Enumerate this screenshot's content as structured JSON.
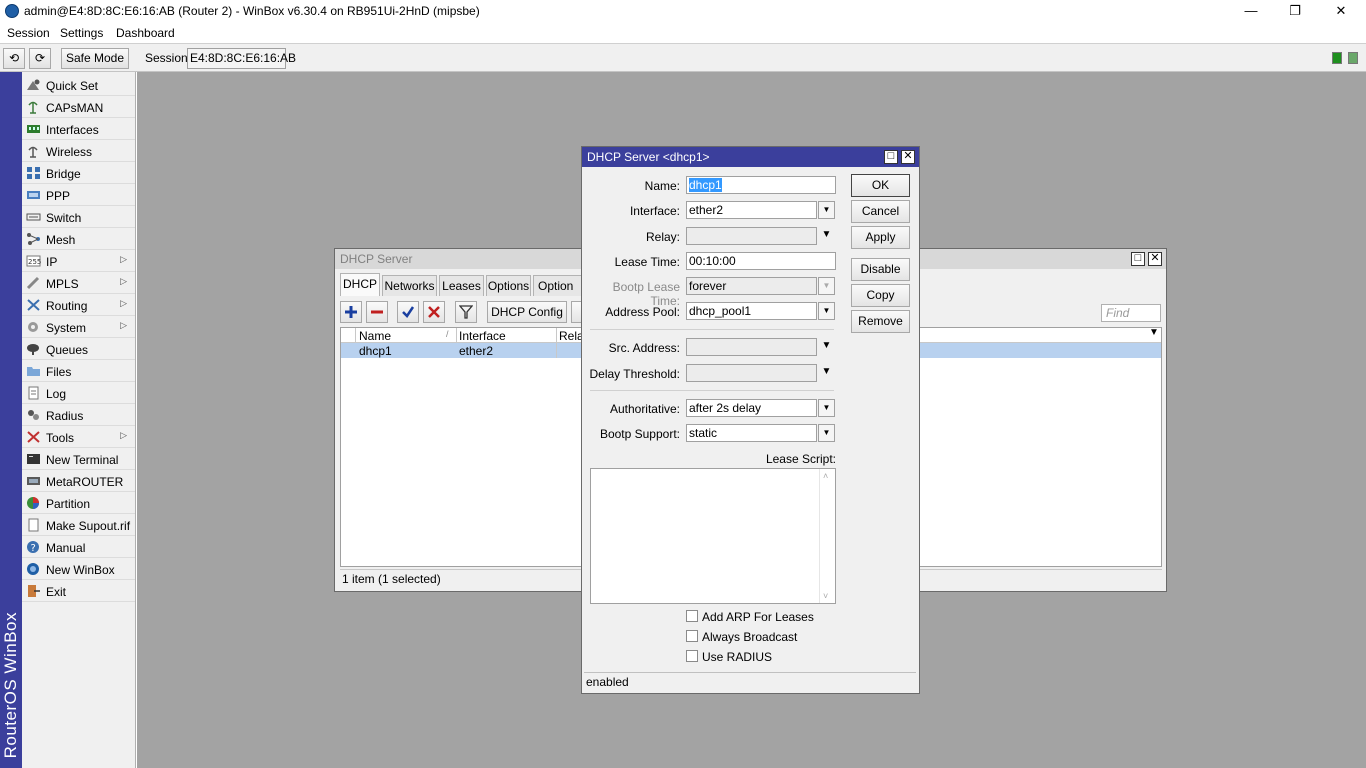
{
  "window": {
    "title": "admin@E4:8D:8C:E6:16:AB (Router 2) - WinBox v6.30.4 on RB951Ui-2HnD (mipsbe)",
    "minimize": "—",
    "restore": "❐",
    "close": "✕"
  },
  "menu": [
    "Session",
    "Settings",
    "Dashboard"
  ],
  "toolbar": {
    "undo": "⟲",
    "redo": "⟳",
    "safe_mode": "Safe Mode",
    "session_label": "Session:",
    "session_value": "E4:8D:8C:E6:16:AB"
  },
  "brand": "RouterOS WinBox",
  "sidebar": [
    {
      "label": "Quick Set",
      "icon": "quick-set-icon",
      "submenu": false
    },
    {
      "label": "CAPsMAN",
      "icon": "capsman-icon",
      "submenu": false
    },
    {
      "label": "Interfaces",
      "icon": "interfaces-icon",
      "submenu": false
    },
    {
      "label": "Wireless",
      "icon": "wireless-icon",
      "submenu": false
    },
    {
      "label": "Bridge",
      "icon": "bridge-icon",
      "submenu": false
    },
    {
      "label": "PPP",
      "icon": "ppp-icon",
      "submenu": false
    },
    {
      "label": "Switch",
      "icon": "switch-icon",
      "submenu": false
    },
    {
      "label": "Mesh",
      "icon": "mesh-icon",
      "submenu": false
    },
    {
      "label": "IP",
      "icon": "ip-icon",
      "submenu": true
    },
    {
      "label": "MPLS",
      "icon": "mpls-icon",
      "submenu": true
    },
    {
      "label": "Routing",
      "icon": "routing-icon",
      "submenu": true
    },
    {
      "label": "System",
      "icon": "system-icon",
      "submenu": true
    },
    {
      "label": "Queues",
      "icon": "queues-icon",
      "submenu": false
    },
    {
      "label": "Files",
      "icon": "files-icon",
      "submenu": false
    },
    {
      "label": "Log",
      "icon": "log-icon",
      "submenu": false
    },
    {
      "label": "Radius",
      "icon": "radius-icon",
      "submenu": false
    },
    {
      "label": "Tools",
      "icon": "tools-icon",
      "submenu": true
    },
    {
      "label": "New Terminal",
      "icon": "terminal-icon",
      "submenu": false
    },
    {
      "label": "MetaROUTER",
      "icon": "metarouter-icon",
      "submenu": false
    },
    {
      "label": "Partition",
      "icon": "partition-icon",
      "submenu": false
    },
    {
      "label": "Make Supout.rif",
      "icon": "supout-icon",
      "submenu": false
    },
    {
      "label": "Manual",
      "icon": "manual-icon",
      "submenu": false
    },
    {
      "label": "New WinBox",
      "icon": "winbox-icon",
      "submenu": false
    },
    {
      "label": "Exit",
      "icon": "exit-icon",
      "submenu": false
    }
  ],
  "dhcp_list": {
    "title": "DHCP Server",
    "tabs": [
      "DHCP",
      "Networks",
      "Leases",
      "Options",
      "Option Se"
    ],
    "buttons": {
      "dhcp_config": "DHCP Config"
    },
    "find_placeholder": "Find",
    "columns": [
      "Name",
      "Interface",
      "Relay"
    ],
    "rows": [
      {
        "name": "dhcp1",
        "interface": "ether2"
      }
    ],
    "status": "1 item (1 selected)"
  },
  "dialog": {
    "title": "DHCP Server <dhcp1>",
    "fields": {
      "name": {
        "label": "Name:",
        "value": "dhcp1"
      },
      "interface": {
        "label": "Interface:",
        "value": "ether2"
      },
      "relay": {
        "label": "Relay:",
        "value": ""
      },
      "lease_time": {
        "label": "Lease Time:",
        "value": "00:10:00"
      },
      "bootp_lease_time": {
        "label": "Bootp Lease Time:",
        "value": "forever"
      },
      "address_pool": {
        "label": "Address Pool:",
        "value": "dhcp_pool1"
      },
      "src_address": {
        "label": "Src. Address:",
        "value": ""
      },
      "delay_threshold": {
        "label": "Delay Threshold:",
        "value": ""
      },
      "authoritative": {
        "label": "Authoritative:",
        "value": "after 2s delay"
      },
      "bootp_support": {
        "label": "Bootp Support:",
        "value": "static"
      },
      "lease_script": {
        "label": "Lease Script:"
      }
    },
    "checkboxes": {
      "add_arp": "Add ARP For Leases",
      "always_broadcast": "Always Broadcast",
      "use_radius": "Use RADIUS"
    },
    "buttons": {
      "ok": "OK",
      "cancel": "Cancel",
      "apply": "Apply",
      "disable": "Disable",
      "copy": "Copy",
      "remove": "Remove"
    },
    "status": "enabled"
  }
}
